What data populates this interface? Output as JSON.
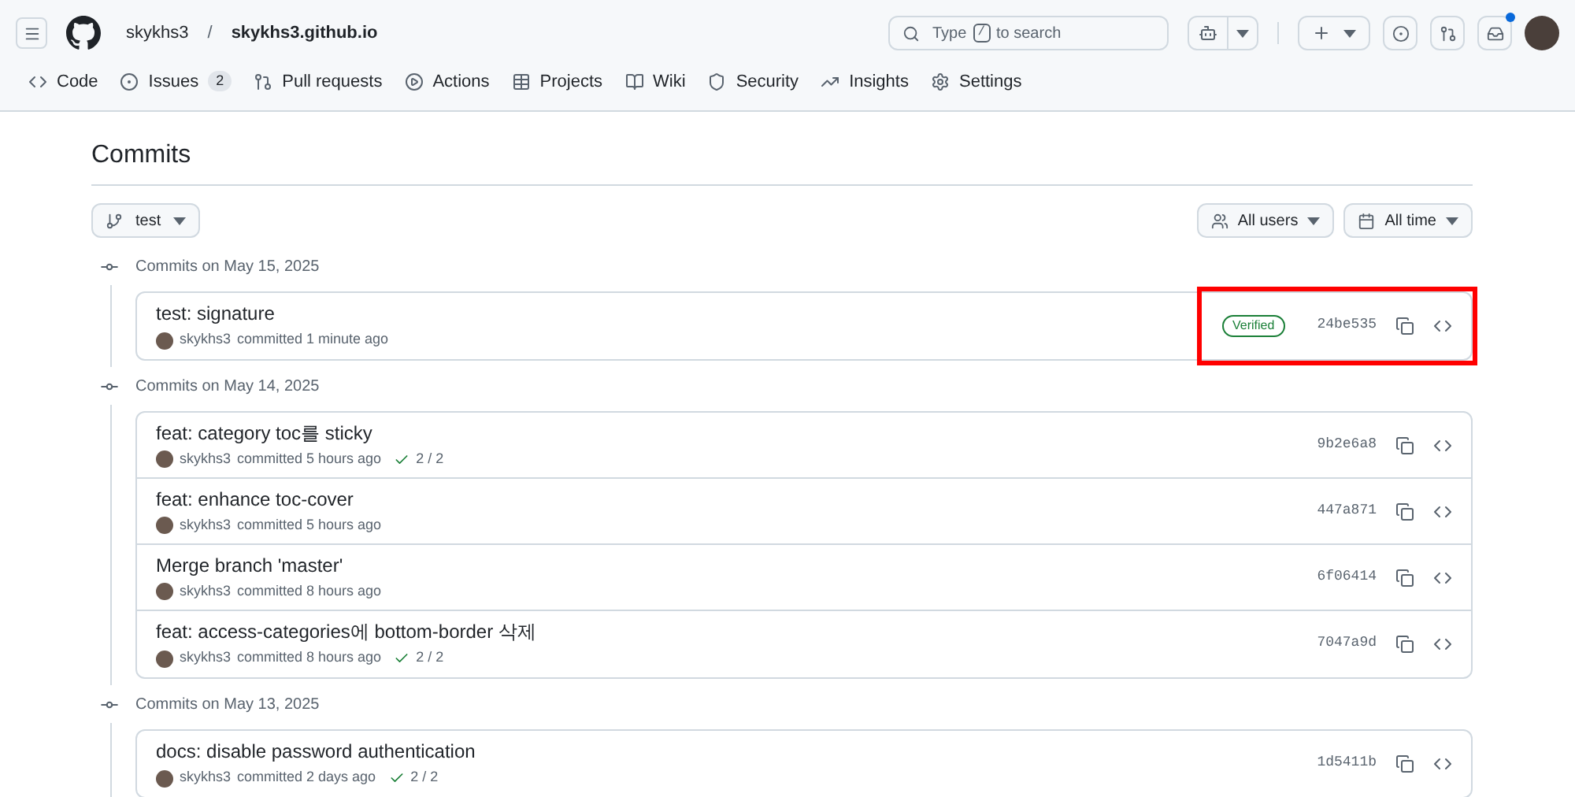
{
  "header": {
    "owner": "skykhs3",
    "separator": "/",
    "repo": "skykhs3.github.io",
    "search": {
      "prefix": "Type",
      "key": "/",
      "suffix": "to search"
    },
    "inbox_unread": true
  },
  "tabs": [
    {
      "label": "Code",
      "selected": false
    },
    {
      "label": "Issues",
      "count": "2",
      "selected": false
    },
    {
      "label": "Pull requests",
      "selected": false
    },
    {
      "label": "Actions",
      "selected": false
    },
    {
      "label": "Projects",
      "selected": false
    },
    {
      "label": "Wiki",
      "selected": false
    },
    {
      "label": "Security",
      "selected": false
    },
    {
      "label": "Insights",
      "selected": false
    },
    {
      "label": "Settings",
      "selected": false
    }
  ],
  "page_title": "Commits",
  "branch": "test",
  "filters": [
    {
      "label": "All users"
    },
    {
      "label": "All time"
    }
  ],
  "groups": [
    {
      "date": "Commits on May 15, 2025",
      "commits": [
        {
          "title": "test: signature",
          "author": "skykhs3",
          "time": "committed 1 minute ago",
          "verified": "Verified",
          "sha": "24be535",
          "highlighted": true
        }
      ]
    },
    {
      "date": "Commits on May 14, 2025",
      "commits": [
        {
          "title": "feat: category toc를 sticky",
          "author": "skykhs3",
          "time": "committed 5 hours ago",
          "checks": "2 / 2",
          "sha": "9b2e6a8",
          "highlighted": false
        },
        {
          "title": "feat: enhance toc-cover",
          "author": "skykhs3",
          "time": "committed 5 hours ago",
          "sha": "447a871",
          "highlighted": false
        },
        {
          "title": "Merge branch 'master'",
          "author": "skykhs3",
          "time": "committed 8 hours ago",
          "sha": "6f06414",
          "highlighted": false
        },
        {
          "title": "feat: access-categories에 bottom-border 삭제",
          "author": "skykhs3",
          "time": "committed 8 hours ago",
          "checks": "2 / 2",
          "sha": "7047a9d",
          "highlighted": false
        }
      ]
    },
    {
      "date": "Commits on May 13, 2025",
      "commits": [
        {
          "title": "docs: disable password authentication",
          "author": "skykhs3",
          "time": "committed 2 days ago",
          "checks": "2 / 2",
          "sha": "1d5411b",
          "highlighted": false
        }
      ]
    }
  ]
}
